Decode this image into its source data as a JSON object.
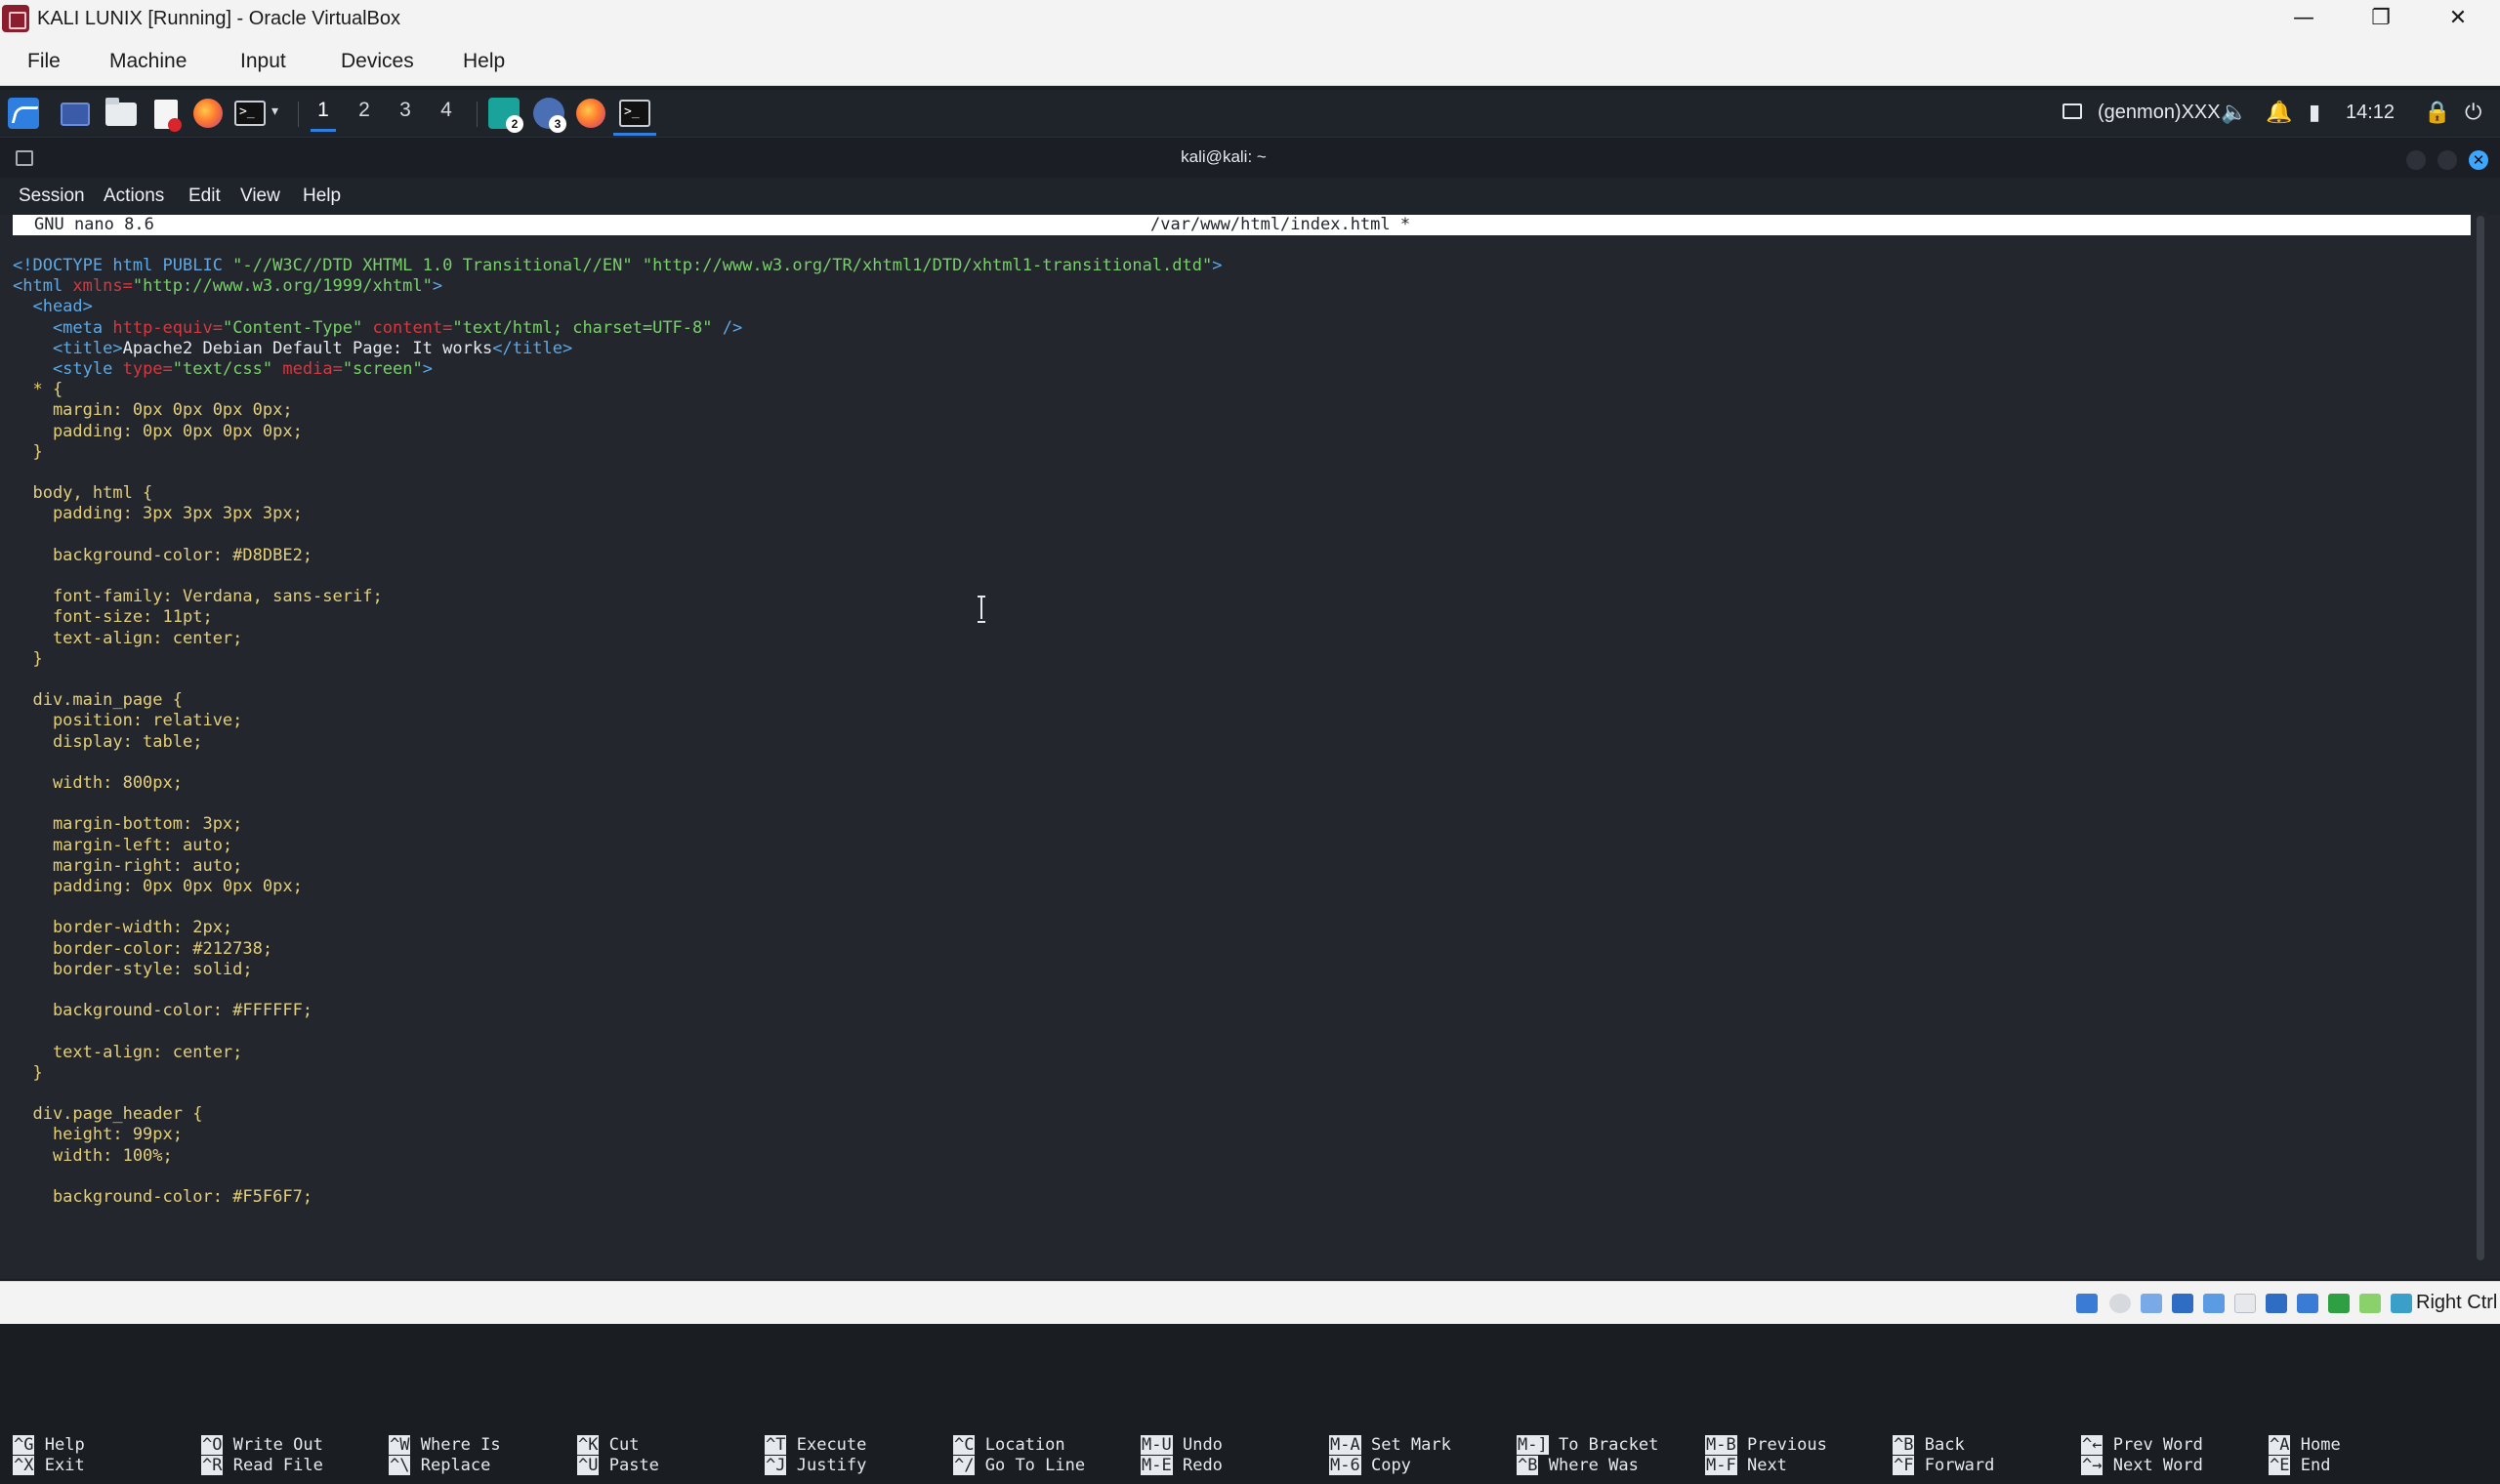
{
  "vbox": {
    "title": "KALI LUNIX [Running] - Oracle VirtualBox",
    "menu": [
      "File",
      "Machine",
      "Input",
      "Devices",
      "Help"
    ],
    "window_controls": {
      "minimize": "—",
      "restore": "❐",
      "close": "✕"
    },
    "status_host_key": "Right Ctrl"
  },
  "panel": {
    "workspaces": [
      "1",
      "2",
      "3",
      "4"
    ],
    "active_workspace": "1",
    "task_badges": [
      "2",
      "3"
    ],
    "genmon": "(genmon)XXX",
    "clock": "14:12",
    "icons": [
      "kali-menu-icon",
      "show-desktop-icon",
      "file-manager-icon",
      "text-editor-icon",
      "firefox-icon",
      "terminal-icon"
    ],
    "accent_color": "#2f7fe0"
  },
  "terminal": {
    "title": "kali@kali: ~",
    "menu": [
      "Session",
      "Actions",
      "Edit",
      "View",
      "Help"
    ]
  },
  "nano": {
    "version": "GNU nano 8.6",
    "file": "/var/www/html/index.html *",
    "lines": [
      [
        [
          "tag",
          "<!DOCTYPE html PUBLIC "
        ],
        [
          "str",
          "\"-//W3C//DTD XHTML 1.0 Transitional//EN\""
        ],
        [
          "tag",
          " "
        ],
        [
          "str",
          "\"http://www.w3.org/TR/xhtml1/DTD/xhtml1-transitional.dtd\""
        ],
        [
          "tag",
          ">"
        ]
      ],
      [
        [
          "tag",
          "<html "
        ],
        [
          "attr",
          "xmlns="
        ],
        [
          "str",
          "\"http://www.w3.org/1999/xhtml\""
        ],
        [
          "tag",
          ">"
        ]
      ],
      [
        [
          "tag",
          "  <head>"
        ]
      ],
      [
        [
          "tag",
          "    <meta "
        ],
        [
          "attr",
          "http-equiv="
        ],
        [
          "str",
          "\"Content-Type\""
        ],
        [
          "tag",
          " "
        ],
        [
          "attr",
          "content="
        ],
        [
          "str",
          "\"text/html; charset=UTF-8\""
        ],
        [
          "tag",
          " />"
        ]
      ],
      [
        [
          "tag",
          "    <title>"
        ],
        [
          "plain",
          "Apache2 Debian Default Page: It works"
        ],
        [
          "tag",
          "</title>"
        ]
      ],
      [
        [
          "tag",
          "    <style "
        ],
        [
          "attr",
          "type="
        ],
        [
          "str",
          "\"text/css\""
        ],
        [
          "tag",
          " "
        ],
        [
          "attr",
          "media="
        ],
        [
          "str",
          "\"screen\""
        ],
        [
          "tag",
          ">"
        ]
      ],
      [
        [
          "css",
          "  * {"
        ]
      ],
      [
        [
          "css",
          "    margin: 0px 0px 0px 0px;"
        ]
      ],
      [
        [
          "css",
          "    padding: 0px 0px 0px 0px;"
        ]
      ],
      [
        [
          "css",
          "  }"
        ]
      ],
      [
        [
          "css",
          ""
        ]
      ],
      [
        [
          "css",
          "  body, html {"
        ]
      ],
      [
        [
          "css",
          "    padding: 3px 3px 3px 3px;"
        ]
      ],
      [
        [
          "css",
          ""
        ]
      ],
      [
        [
          "css",
          "    background-color: #D8DBE2;"
        ]
      ],
      [
        [
          "css",
          ""
        ]
      ],
      [
        [
          "css",
          "    font-family: Verdana, sans-serif;"
        ]
      ],
      [
        [
          "css",
          "    font-size: 11pt;"
        ]
      ],
      [
        [
          "css",
          "    text-align: center;"
        ]
      ],
      [
        [
          "css",
          "  }"
        ]
      ],
      [
        [
          "css",
          ""
        ]
      ],
      [
        [
          "css",
          "  div.main_page {"
        ]
      ],
      [
        [
          "css",
          "    position: relative;"
        ]
      ],
      [
        [
          "css",
          "    display: table;"
        ]
      ],
      [
        [
          "css",
          ""
        ]
      ],
      [
        [
          "css",
          "    width: 800px;"
        ]
      ],
      [
        [
          "css",
          ""
        ]
      ],
      [
        [
          "css",
          "    margin-bottom: 3px;"
        ]
      ],
      [
        [
          "css",
          "    margin-left: auto;"
        ]
      ],
      [
        [
          "css",
          "    margin-right: auto;"
        ]
      ],
      [
        [
          "css",
          "    padding: 0px 0px 0px 0px;"
        ]
      ],
      [
        [
          "css",
          ""
        ]
      ],
      [
        [
          "css",
          "    border-width: 2px;"
        ]
      ],
      [
        [
          "css",
          "    border-color: #212738;"
        ]
      ],
      [
        [
          "css",
          "    border-style: solid;"
        ]
      ],
      [
        [
          "css",
          ""
        ]
      ],
      [
        [
          "css",
          "    background-color: #FFFFFF;"
        ]
      ],
      [
        [
          "css",
          ""
        ]
      ],
      [
        [
          "css",
          "    text-align: center;"
        ]
      ],
      [
        [
          "css",
          "  }"
        ]
      ],
      [
        [
          "css",
          ""
        ]
      ],
      [
        [
          "css",
          "  div.page_header {"
        ]
      ],
      [
        [
          "css",
          "    height: 99px;"
        ]
      ],
      [
        [
          "css",
          "    width: 100%;"
        ]
      ],
      [
        [
          "css",
          ""
        ]
      ],
      [
        [
          "css",
          "    background-color: #F5F6F7;"
        ]
      ]
    ],
    "shortcuts": [
      [
        {
          "key": "^G",
          "label": "Help"
        },
        {
          "key": "^X",
          "label": "Exit"
        }
      ],
      [
        {
          "key": "^O",
          "label": "Write Out"
        },
        {
          "key": "^R",
          "label": "Read File"
        }
      ],
      [
        {
          "key": "^W",
          "label": "Where Is"
        },
        {
          "key": "^\\",
          "label": "Replace"
        }
      ],
      [
        {
          "key": "^K",
          "label": "Cut"
        },
        {
          "key": "^U",
          "label": "Paste"
        }
      ],
      [
        {
          "key": "^T",
          "label": "Execute"
        },
        {
          "key": "^J",
          "label": "Justify"
        }
      ],
      [
        {
          "key": "^C",
          "label": "Location"
        },
        {
          "key": "^/",
          "label": "Go To Line"
        }
      ],
      [
        {
          "key": "M-U",
          "label": "Undo"
        },
        {
          "key": "M-E",
          "label": "Redo"
        }
      ],
      [
        {
          "key": "M-A",
          "label": "Set Mark"
        },
        {
          "key": "M-6",
          "label": "Copy"
        }
      ],
      [
        {
          "key": "M-]",
          "label": "To Bracket"
        },
        {
          "key": "^B",
          "label": "Where Was"
        }
      ],
      [
        {
          "key": "M-B",
          "label": "Previous"
        },
        {
          "key": "M-F",
          "label": "Next"
        }
      ],
      [
        {
          "key": "^B",
          "label": "Back"
        },
        {
          "key": "^F",
          "label": "Forward"
        }
      ],
      [
        {
          "key": "^←",
          "label": "Prev Word"
        },
        {
          "key": "^→",
          "label": "Next Word"
        }
      ],
      [
        {
          "key": "^A",
          "label": "Home"
        },
        {
          "key": "^E",
          "label": "End"
        }
      ]
    ]
  }
}
